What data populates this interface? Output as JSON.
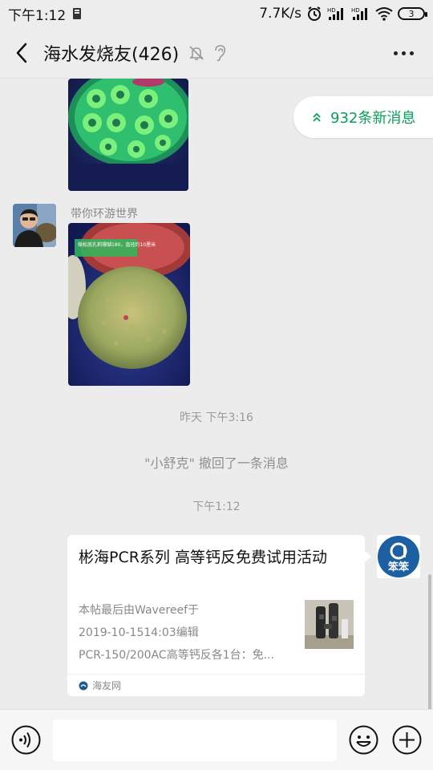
{
  "status_bar": {
    "time": "下午1:12",
    "speed": "7.7K/s",
    "battery": "3"
  },
  "header": {
    "title": "海水发烧友(426)"
  },
  "new_messages": {
    "label": "932条新消息"
  },
  "messages": {
    "sender_name": "带你环游世界",
    "image_caption": "微松底孔莉珊瑚180，直径约10厘米",
    "time_1": "昨天 下午3:16",
    "recall_notice": "\"小舒克\" 撤回了一条消息",
    "time_2": "下午1:12"
  },
  "link_card": {
    "title": "彬海PCR系列 高等钙反免费试用活动",
    "desc_line1": "本帖最后由Wavereef于",
    "desc_line2": "2019-10-1514:03编辑",
    "desc_line3": "PCR-150/200AC高等钙反各1台：免...",
    "source": "海友网",
    "avatar_text": "笨笨"
  },
  "colors": {
    "accent_green": "#07a05a",
    "background": "#ececec"
  }
}
